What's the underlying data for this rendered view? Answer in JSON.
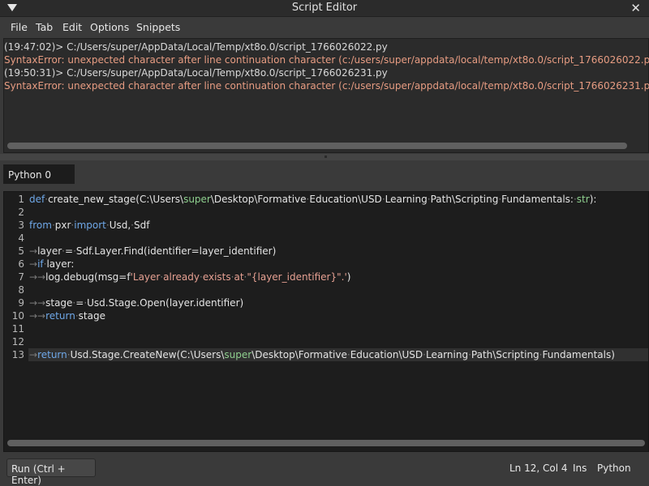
{
  "window": {
    "title": "Script Editor",
    "close_glyph": "✕"
  },
  "menubar": {
    "items": [
      "File",
      "Tab",
      "Edit",
      "Options",
      "Snippets"
    ]
  },
  "output": {
    "lines": [
      {
        "kind": "info",
        "text": "(19:47:02)> C:/Users/super/AppData/Local/Temp/xt8o.0/script_1766026022.py"
      },
      {
        "kind": "err",
        "text": "SyntaxError: unexpected character after line continuation character (c:/users/super/appdata/local/temp/xt8o.0/script_1766026022.py, lin"
      },
      {
        "kind": "info",
        "text": "(19:50:31)> C:/Users/super/AppData/Local/Temp/xt8o.0/script_1766026231.py"
      },
      {
        "kind": "err",
        "text": "SyntaxError: unexpected character after line continuation character (c:/users/super/appdata/local/temp/xt8o.0/script_1766026231.py, lin"
      }
    ]
  },
  "tabs": [
    {
      "label": "Python 0"
    }
  ],
  "editor": {
    "line_numbers": [
      "1",
      "2",
      "3",
      "4",
      "5",
      "6",
      "7",
      "8",
      "9",
      "10",
      "11",
      "12",
      "13"
    ],
    "current_line": 13
  },
  "status": {
    "run_label": "Run (Ctrl + Enter)",
    "position": "Ln 12, Col 4",
    "mode": "Ins",
    "language": "Python"
  },
  "colors": {
    "keyword": "#6fa8e8",
    "string": "#e6a092",
    "highlight": "#8ecf8e",
    "error": "#e79c82"
  },
  "icons": {
    "menu": "triangle-down-icon",
    "close": "close-icon",
    "tab_whitespace": "arrow-right-icon"
  }
}
